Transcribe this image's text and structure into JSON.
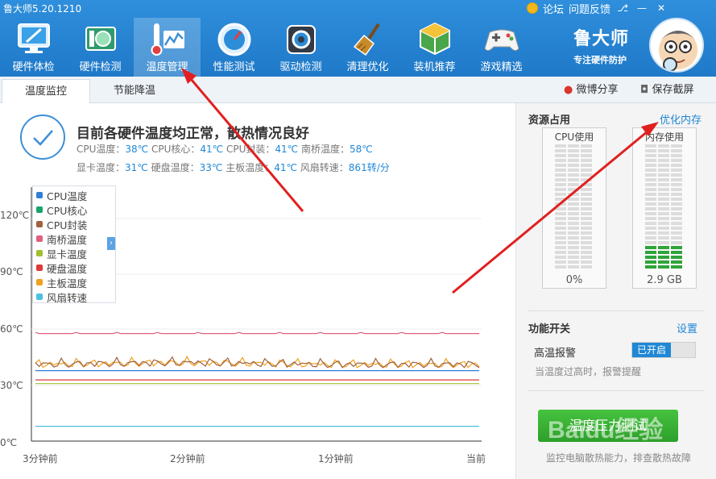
{
  "app": {
    "title": "鲁大师5.20.1210"
  },
  "top_links": {
    "forum": "论坛",
    "feedback": "问题反馈"
  },
  "window_controls": [
    "⎇",
    "—",
    "✕"
  ],
  "nav": [
    {
      "label": "硬件体检",
      "icon": "monitor-icon",
      "color": "#3aa0e8"
    },
    {
      "label": "硬件检测",
      "icon": "hardware-board-icon",
      "color": "#2e9a6e"
    },
    {
      "label": "温度管理",
      "icon": "thermometer-chart-icon",
      "color": "#3d8fd6",
      "active": true
    },
    {
      "label": "性能测试",
      "icon": "speedometer-icon",
      "color": "#2c8dd8"
    },
    {
      "label": "驱动检测",
      "icon": "gear-chip-icon",
      "color": "#333a45"
    },
    {
      "label": "清理优化",
      "icon": "broom-icon",
      "color": "#c98b2a"
    },
    {
      "label": "装机推荐",
      "icon": "cube-icon",
      "color": "#4aa64a"
    },
    {
      "label": "游戏精选",
      "icon": "gamepad-icon",
      "color": "#f4f4f4"
    }
  ],
  "brand": {
    "name": "鲁大师",
    "slogan": "专注硬件防护"
  },
  "tabs": [
    {
      "label": "温度监控",
      "active": true
    },
    {
      "label": "节能降温",
      "active": false
    }
  ],
  "share": {
    "weibo": "微博分享",
    "screenshot": "保存截屏"
  },
  "status": {
    "title": "目前各硬件温度均正常，散热情况良好",
    "line1": [
      {
        "label": "CPU温度：",
        "value": "38℃"
      },
      {
        "label": "CPU核心：",
        "value": "41℃"
      },
      {
        "label": "CPU封装：",
        "value": "41℃"
      },
      {
        "label": "南桥温度：",
        "value": "58℃"
      }
    ],
    "line2": [
      {
        "label": "显卡温度：",
        "value": "31℃"
      },
      {
        "label": "硬盘温度：",
        "value": "33℃"
      },
      {
        "label": "主板温度：",
        "value": "41℃"
      },
      {
        "label": "风扇转速：",
        "value": "861转/分"
      }
    ]
  },
  "chart": {
    "y_ticks": [
      "120℃",
      "90℃",
      "60℃",
      "30℃",
      "0℃"
    ],
    "x_ticks": [
      "3分钟前",
      "2分钟前",
      "1分钟前",
      "当前"
    ],
    "legend": [
      {
        "name": "CPU温度",
        "color": "#2f7ed8"
      },
      {
        "name": "CPU核心",
        "color": "#1aa36b"
      },
      {
        "name": "CPU封装",
        "color": "#a0623d"
      },
      {
        "name": "南桥温度",
        "color": "#e0607e"
      },
      {
        "name": "显卡温度",
        "color": "#a0c030"
      },
      {
        "name": "硬盘温度",
        "color": "#e03a3a"
      },
      {
        "name": "主板温度",
        "color": "#f0a020"
      },
      {
        "name": "风扇转速",
        "color": "#4cc0e0"
      }
    ]
  },
  "chart_data": {
    "type": "line",
    "ylim": [
      0,
      120
    ],
    "y_ticks": [
      0,
      30,
      60,
      90,
      120
    ],
    "x": [
      "3分钟前",
      "2分钟前",
      "1分钟前",
      "当前"
    ],
    "series": [
      {
        "name": "南桥温度",
        "values": [
          58,
          58,
          58,
          58
        ]
      },
      {
        "name": "主板温度",
        "values": [
          41,
          42,
          41,
          41
        ]
      },
      {
        "name": "CPU封装",
        "values": [
          41,
          42,
          41,
          41
        ]
      },
      {
        "name": "CPU温度",
        "values": [
          38,
          38,
          38,
          38
        ]
      },
      {
        "name": "硬盘温度",
        "values": [
          33,
          33,
          33,
          33
        ]
      },
      {
        "name": "显卡温度",
        "values": [
          31,
          31,
          31,
          31
        ]
      },
      {
        "name": "风扇转速",
        "values": [
          8,
          8,
          8,
          8
        ]
      }
    ]
  },
  "resources": {
    "title": "资源占用",
    "optimize_link": "优化内存",
    "cpu": {
      "label": "CPU使用",
      "value": "0%",
      "fill": 0
    },
    "memory": {
      "label": "内存使用",
      "value": "2.9 GB",
      "fill": 0.2
    }
  },
  "features": {
    "title": "功能开关",
    "settings_link": "设置",
    "high_temp_alarm": {
      "label": "高温报警",
      "toggle": "已开启",
      "desc": "当温度过高时，报警提醒"
    }
  },
  "pressure_test": {
    "button": "温度压力测试",
    "desc": "监控电脑散热能力，排查散热故障"
  },
  "watermark": "Baidu经验"
}
